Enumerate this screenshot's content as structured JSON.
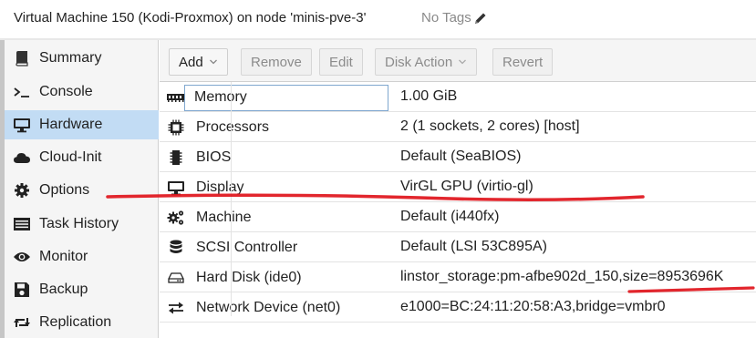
{
  "header": {
    "title": "Virtual Machine 150 (Kodi-Proxmox) on node 'minis-pve-3'",
    "tags_label": "No Tags"
  },
  "sidebar": {
    "items": [
      {
        "label": "Summary",
        "icon": "book-icon",
        "active": false
      },
      {
        "label": "Console",
        "icon": "terminal-icon",
        "active": false
      },
      {
        "label": "Hardware",
        "icon": "desktop-icon",
        "active": true
      },
      {
        "label": "Cloud-Init",
        "icon": "cloud-icon",
        "active": false
      },
      {
        "label": "Options",
        "icon": "gear-icon",
        "active": false
      },
      {
        "label": "Task History",
        "icon": "list-icon",
        "active": false
      },
      {
        "label": "Monitor",
        "icon": "eye-icon",
        "active": false
      },
      {
        "label": "Backup",
        "icon": "floppy-icon",
        "active": false
      },
      {
        "label": "Replication",
        "icon": "retweet-icon",
        "active": false
      }
    ]
  },
  "toolbar": {
    "add_label": "Add",
    "remove_label": "Remove",
    "edit_label": "Edit",
    "disk_action_label": "Disk Action",
    "revert_label": "Revert"
  },
  "hardware": {
    "rows": [
      {
        "key": "Memory",
        "value": "1.00 GiB",
        "icon": "memory-icon"
      },
      {
        "key": "Processors",
        "value": "2 (1 sockets, 2 cores) [host]",
        "icon": "cpu-icon"
      },
      {
        "key": "BIOS",
        "value": "Default (SeaBIOS)",
        "icon": "microchip-icon"
      },
      {
        "key": "Display",
        "value": "VirGL GPU (virtio-gl)",
        "icon": "display-icon"
      },
      {
        "key": "Machine",
        "value": "Default (i440fx)",
        "icon": "cogs-icon"
      },
      {
        "key": "SCSI Controller",
        "value": "Default (LSI 53C895A)",
        "icon": "database-icon"
      },
      {
        "key": "Hard Disk (ide0)",
        "value": "linstor_storage:pm-afbe902d_150,size=8953696K",
        "icon": "hdd-icon"
      },
      {
        "key": "Network Device (net0)",
        "value": "e1000=BC:24:11:20:58:A3,bridge=vmbr0",
        "icon": "exchange-icon"
      }
    ]
  },
  "colors": {
    "active_nav": "#c2dcf4",
    "annotation_red": "#e0131b"
  }
}
